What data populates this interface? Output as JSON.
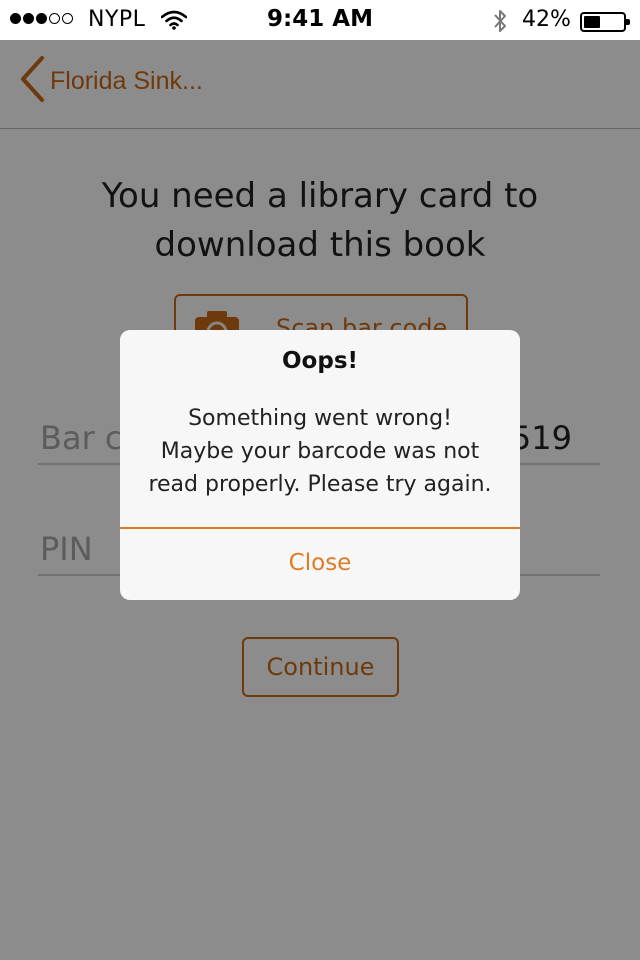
{
  "status_bar": {
    "signal_filled": 3,
    "signal_total": 5,
    "carrier": "NYPL",
    "time": "9:41 AM",
    "battery_percent": "42%",
    "battery_level": 0.42
  },
  "nav": {
    "back_label": "Florida Sink..."
  },
  "content": {
    "heading": "You need a library card to download this book",
    "scan_button_label": "Scan bar code",
    "barcode_placeholder": "Bar c",
    "barcode_value_visible": "519",
    "pin_placeholder": "PIN",
    "continue_label": "Continue"
  },
  "alert": {
    "title": "Oops!",
    "message_lines": [
      "Something went wrong!",
      "Maybe your barcode was not",
      "read properly. Please try again."
    ],
    "close_label": "Close"
  },
  "colors": {
    "accent": "#c96a17",
    "alert_accent": "#e07b24"
  },
  "icons": {
    "back": "chevron-left-icon",
    "camera": "camera-icon",
    "wifi": "wifi-icon",
    "bluetooth": "bluetooth-icon",
    "battery": "battery-icon"
  }
}
